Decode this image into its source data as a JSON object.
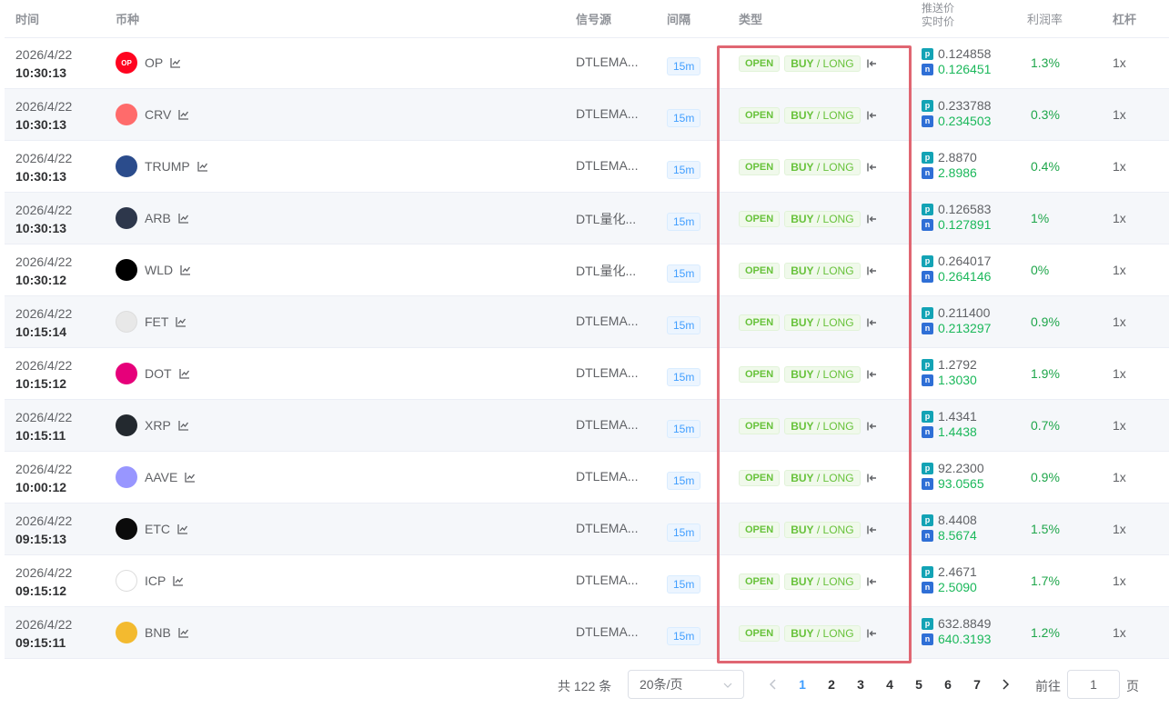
{
  "header": {
    "time": "时间",
    "coin": "币种",
    "source": "信号源",
    "interval": "间隔",
    "type": "类型",
    "price_push": "推送价",
    "price_live": "实时价",
    "profit": "利润率",
    "leverage": "杠杆"
  },
  "labels": {
    "open": "OPEN",
    "buy": "BUY",
    "slash": " / ",
    "long": "LONG",
    "p": "p",
    "n": "n"
  },
  "icons": {
    "chart": "trend-chart-icon",
    "close": "close-position-icon"
  },
  "rows": [
    {
      "date": "2026/4/22",
      "clock": "10:30:13",
      "coin": "OP",
      "source": "DTLEMA...",
      "interval": "15m",
      "push": "0.124858",
      "live": "0.126451",
      "profit": "1.3%",
      "leverage": "1x",
      "icon_color": "#ff0420",
      "icon_text": "OP"
    },
    {
      "date": "2026/4/22",
      "clock": "10:30:13",
      "coin": "CRV",
      "source": "DTLEMA...",
      "interval": "15m",
      "push": "0.233788",
      "live": "0.234503",
      "profit": "0.3%",
      "leverage": "1x",
      "icon_color": "#ff6b6b",
      "icon_text": ""
    },
    {
      "date": "2026/4/22",
      "clock": "10:30:13",
      "coin": "TRUMP",
      "source": "DTLEMA...",
      "interval": "15m",
      "push": "2.8870",
      "live": "2.8986",
      "profit": "0.4%",
      "leverage": "1x",
      "icon_color": "#2b4c8c",
      "icon_text": ""
    },
    {
      "date": "2026/4/22",
      "clock": "10:30:13",
      "coin": "ARB",
      "source": "DTL量化...",
      "interval": "15m",
      "push": "0.126583",
      "live": "0.127891",
      "profit": "1%",
      "leverage": "1x",
      "icon_color": "#2d374b",
      "icon_text": ""
    },
    {
      "date": "2026/4/22",
      "clock": "10:30:12",
      "coin": "WLD",
      "source": "DTL量化...",
      "interval": "15m",
      "push": "0.264017",
      "live": "0.264146",
      "profit": "0%",
      "leverage": "1x",
      "icon_color": "#000000",
      "icon_text": ""
    },
    {
      "date": "2026/4/22",
      "clock": "10:15:14",
      "coin": "FET",
      "source": "DTLEMA...",
      "interval": "15m",
      "push": "0.211400",
      "live": "0.213297",
      "profit": "0.9%",
      "leverage": "1x",
      "icon_color": "#e8e8e8",
      "icon_text": ""
    },
    {
      "date": "2026/4/22",
      "clock": "10:15:12",
      "coin": "DOT",
      "source": "DTLEMA...",
      "interval": "15m",
      "push": "1.2792",
      "live": "1.3030",
      "profit": "1.9%",
      "leverage": "1x",
      "icon_color": "#e6007a",
      "icon_text": ""
    },
    {
      "date": "2026/4/22",
      "clock": "10:15:11",
      "coin": "XRP",
      "source": "DTLEMA...",
      "interval": "15m",
      "push": "1.4341",
      "live": "1.4438",
      "profit": "0.7%",
      "leverage": "1x",
      "icon_color": "#23292f",
      "icon_text": ""
    },
    {
      "date": "2026/4/22",
      "clock": "10:00:12",
      "coin": "AAVE",
      "source": "DTLEMA...",
      "interval": "15m",
      "push": "92.2300",
      "live": "93.0565",
      "profit": "0.9%",
      "leverage": "1x",
      "icon_color": "#9896ff",
      "icon_text": ""
    },
    {
      "date": "2026/4/22",
      "clock": "09:15:13",
      "coin": "ETC",
      "source": "DTLEMA...",
      "interval": "15m",
      "push": "8.4408",
      "live": "8.5674",
      "profit": "1.5%",
      "leverage": "1x",
      "icon_color": "#0b0b0b",
      "icon_text": ""
    },
    {
      "date": "2026/4/22",
      "clock": "09:15:12",
      "coin": "ICP",
      "source": "DTLEMA...",
      "interval": "15m",
      "push": "2.4671",
      "live": "2.5090",
      "profit": "1.7%",
      "leverage": "1x",
      "icon_color": "#ffffff",
      "icon_text": ""
    },
    {
      "date": "2026/4/22",
      "clock": "09:15:11",
      "coin": "BNB",
      "source": "DTLEMA...",
      "interval": "15m",
      "push": "632.8849",
      "live": "640.3193",
      "profit": "1.2%",
      "leverage": "1x",
      "icon_color": "#f3ba2f",
      "icon_text": ""
    }
  ],
  "pagination": {
    "total": "共 122 条",
    "page_size": "20条/页",
    "pages": [
      "1",
      "2",
      "3",
      "4",
      "5",
      "6",
      "7"
    ],
    "active_page": "1",
    "goto_label": "前往",
    "goto_value": "1",
    "page_suffix": "页"
  },
  "colors": {
    "accent": "#409eff",
    "positive": "#1fa64b",
    "highlight_box": "#e06672",
    "tag_green": "#67c23a"
  }
}
